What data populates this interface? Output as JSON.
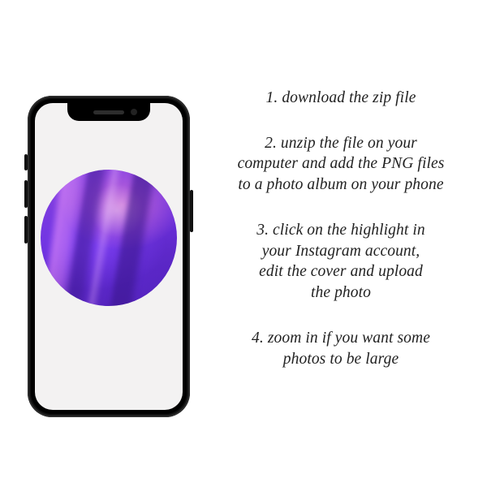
{
  "steps": {
    "s1": "1. download the zip file",
    "s2": "2. unzip the file on your\ncomputer and add the PNG files\nto a photo album on your phone",
    "s3": "3. click on the highlight in\nyour Instagram account,\nedit the cover and upload\nthe photo",
    "s4": "4. zoom in if you want some\nphotos to be large"
  },
  "phone": {
    "cover_name": "purple-watercolor-cover"
  }
}
